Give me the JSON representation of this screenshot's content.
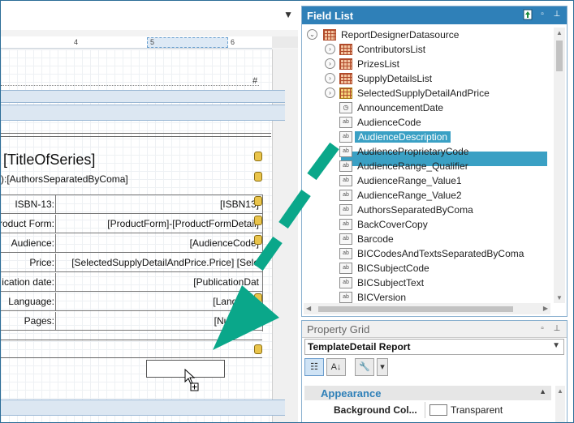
{
  "designer": {
    "ruler_ticks": [
      "4",
      "5",
      "6"
    ],
    "hash_mark": "#",
    "title_of_series": "[TitleOfSeries]",
    "authors_line": "):[AuthorsSeparatedByComa]",
    "rows": [
      {
        "label": "ISBN-13:",
        "value": "[ISBN13]"
      },
      {
        "label": "roduct Form:",
        "value": "[ProductForm]-[ProductFormDetail]"
      },
      {
        "label": "Audience:",
        "value": "[AudienceCode]"
      },
      {
        "label": "Price:",
        "value": "[SelectedSupplyDetailAndPrice.Price]  [Sele"
      },
      {
        "label": "ication date:",
        "value": "[PublicationDat"
      },
      {
        "label": "Language:",
        "value": "[Language"
      },
      {
        "label": "Pages:",
        "value": "[NumberO"
      }
    ]
  },
  "field_list": {
    "title": "Field List",
    "root": "ReportDesignerDatasource",
    "items": [
      {
        "label": "ContributorsList",
        "kind": "table"
      },
      {
        "label": "PrizesList",
        "kind": "table"
      },
      {
        "label": "SupplyDetailsList",
        "kind": "table"
      },
      {
        "label": "SelectedSupplyDetailAndPrice",
        "kind": "table"
      },
      {
        "label": "AnnouncementDate",
        "kind": "date"
      },
      {
        "label": "AudienceCode",
        "kind": "string"
      },
      {
        "label": "AudienceDescription",
        "kind": "string",
        "selected": true
      },
      {
        "label": "AudienceProprietaryCode",
        "kind": "string"
      },
      {
        "label": "AudienceRange_Qualifier",
        "kind": "string"
      },
      {
        "label": "AudienceRange_Value1",
        "kind": "string"
      },
      {
        "label": "AudienceRange_Value2",
        "kind": "string"
      },
      {
        "label": "AuthorsSeparatedByComa",
        "kind": "string"
      },
      {
        "label": "BackCoverCopy",
        "kind": "string"
      },
      {
        "label": "Barcode",
        "kind": "string"
      },
      {
        "label": "BICCodesAndTextsSeparatedByComa",
        "kind": "string"
      },
      {
        "label": "BICSubjectCode",
        "kind": "string"
      },
      {
        "label": "BICSubjectText",
        "kind": "string"
      },
      {
        "label": "BICVersion",
        "kind": "string"
      }
    ]
  },
  "property_grid": {
    "title": "Property Grid",
    "selected_object": "TemplateDetail  Report",
    "category": "Appearance",
    "property_name": "Background Col...",
    "property_value": "Transparent"
  },
  "colors": {
    "accent": "#2f80b8",
    "selection": "#3aa0c4",
    "arrow": "#0aa78a"
  }
}
